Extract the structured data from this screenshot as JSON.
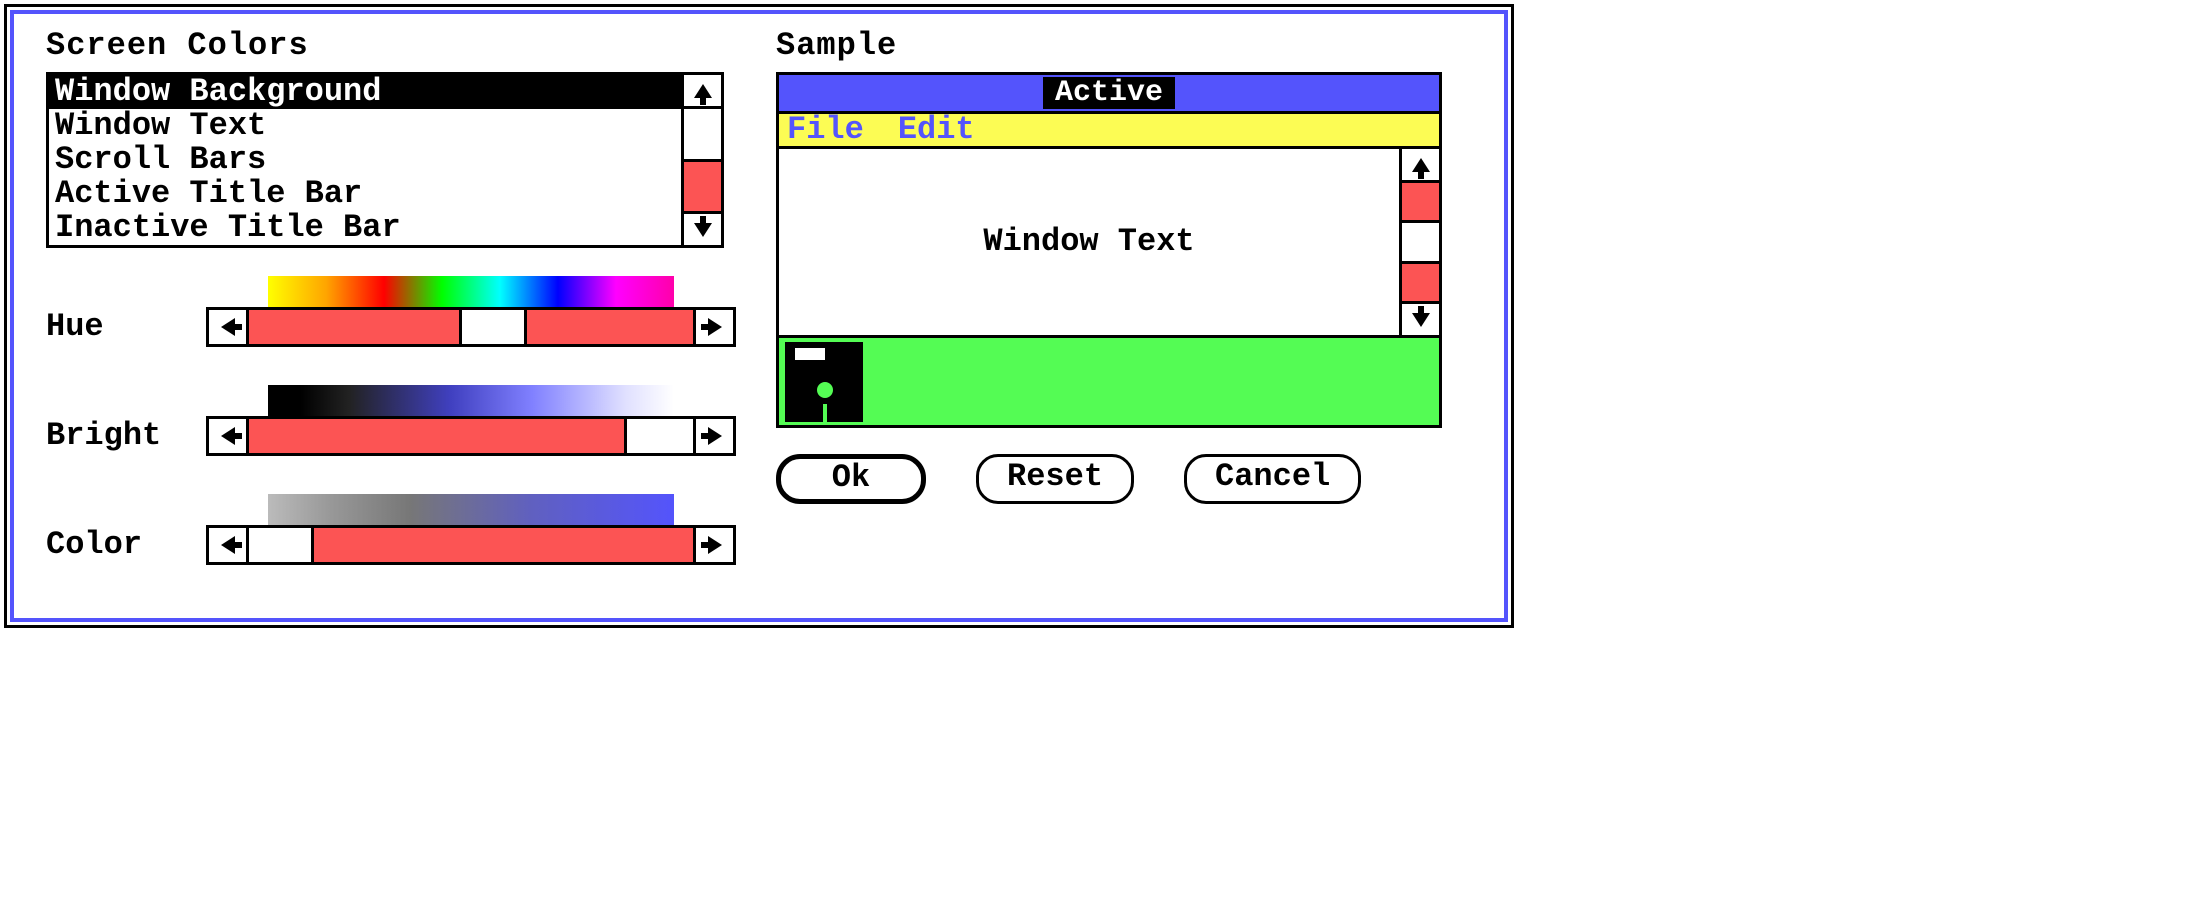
{
  "headings": {
    "screen_colors": "Screen Colors",
    "sample": "Sample"
  },
  "list": {
    "items": [
      "Window Background",
      "Window Text",
      "Scroll Bars",
      "Active Title Bar",
      "Inactive Title Bar"
    ],
    "selected_index": 0
  },
  "sliders": {
    "hue": {
      "label": "Hue",
      "thumb_pos": 0.48
    },
    "bright": {
      "label": "Bright",
      "thumb_pos": 0.85
    },
    "color": {
      "label": "Color",
      "thumb_pos": 0.03
    }
  },
  "sample": {
    "title": "Active",
    "menu": [
      "File",
      "Edit"
    ],
    "window_text": "Window Text"
  },
  "buttons": {
    "ok": "Ok",
    "reset": "Reset",
    "cancel": "Cancel"
  },
  "colors": {
    "frame": "#5454fc",
    "titlebar": "#5454fc",
    "menubar_bg": "#fcfc54",
    "menubar_fg": "#5454fc",
    "scroll_fill": "#fc5454",
    "desktop": "#54fc54"
  }
}
